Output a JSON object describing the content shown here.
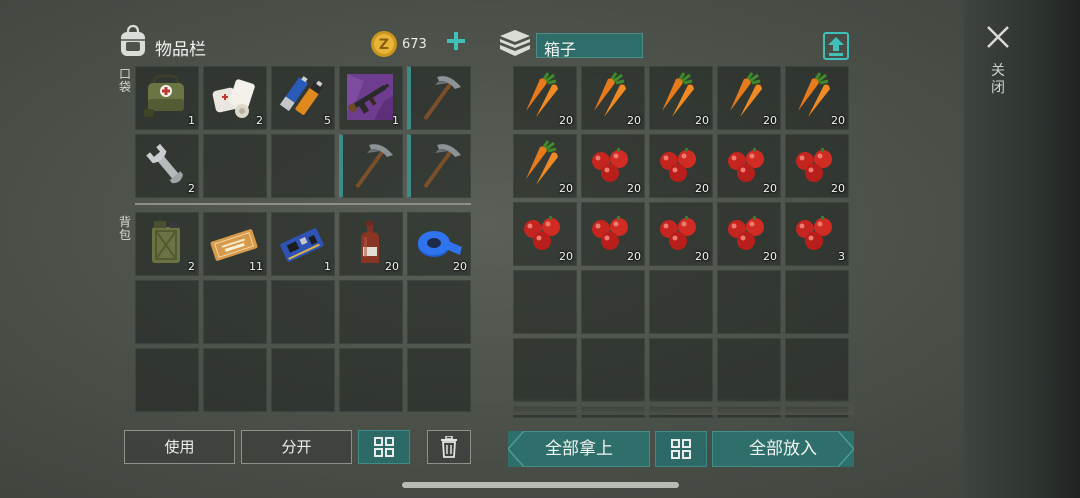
{
  "inventory": {
    "title": "物品栏",
    "coins": "673",
    "pocket_label": "口袋",
    "backpack_label": "背包",
    "pocket": [
      {
        "icon": "first-aid-bag-icon",
        "qty": "1"
      },
      {
        "icon": "bandage-icon",
        "qty": "2"
      },
      {
        "icon": "batteries-icon",
        "qty": "5"
      },
      {
        "icon": "rifle-icon",
        "qty": "1"
      },
      {
        "icon": "pickaxe-icon",
        "qty": ""
      },
      {
        "icon": "wrench-icon",
        "qty": "2"
      },
      {
        "icon": "",
        "qty": ""
      },
      {
        "icon": "",
        "qty": ""
      },
      {
        "icon": "pickaxe-icon",
        "qty": ""
      },
      {
        "icon": "pickaxe-icon",
        "qty": ""
      }
    ],
    "backpack": [
      {
        "icon": "jerrycan-icon",
        "qty": "2"
      },
      {
        "icon": "coupon-icon",
        "qty": "11"
      },
      {
        "icon": "circuit-board-icon",
        "qty": "1"
      },
      {
        "icon": "bottle-icon",
        "qty": "20"
      },
      {
        "icon": "tape-roll-icon",
        "qty": "20"
      }
    ]
  },
  "box": {
    "title": "箱子",
    "items": [
      {
        "icon": "carrot-icon",
        "qty": "20"
      },
      {
        "icon": "carrot-icon",
        "qty": "20"
      },
      {
        "icon": "carrot-icon",
        "qty": "20"
      },
      {
        "icon": "carrot-icon",
        "qty": "20"
      },
      {
        "icon": "carrot-icon",
        "qty": "20"
      },
      {
        "icon": "carrot-icon",
        "qty": "20"
      },
      {
        "icon": "berries-icon",
        "qty": "20"
      },
      {
        "icon": "berries-icon",
        "qty": "20"
      },
      {
        "icon": "berries-icon",
        "qty": "20"
      },
      {
        "icon": "berries-icon",
        "qty": "20"
      },
      {
        "icon": "berries-icon",
        "qty": "20"
      },
      {
        "icon": "berries-icon",
        "qty": "20"
      },
      {
        "icon": "berries-icon",
        "qty": "20"
      },
      {
        "icon": "berries-icon",
        "qty": "20"
      },
      {
        "icon": "berries-icon",
        "qty": "3"
      }
    ]
  },
  "buttons": {
    "use": "使用",
    "split": "分开",
    "take_all": "全部拿上",
    "put_all": "全部放入"
  },
  "close_label": "关闭",
  "colors": {
    "accent": "#2f6f6b",
    "teal_icon": "#3fc0b8",
    "coin": "#d8a62a"
  }
}
